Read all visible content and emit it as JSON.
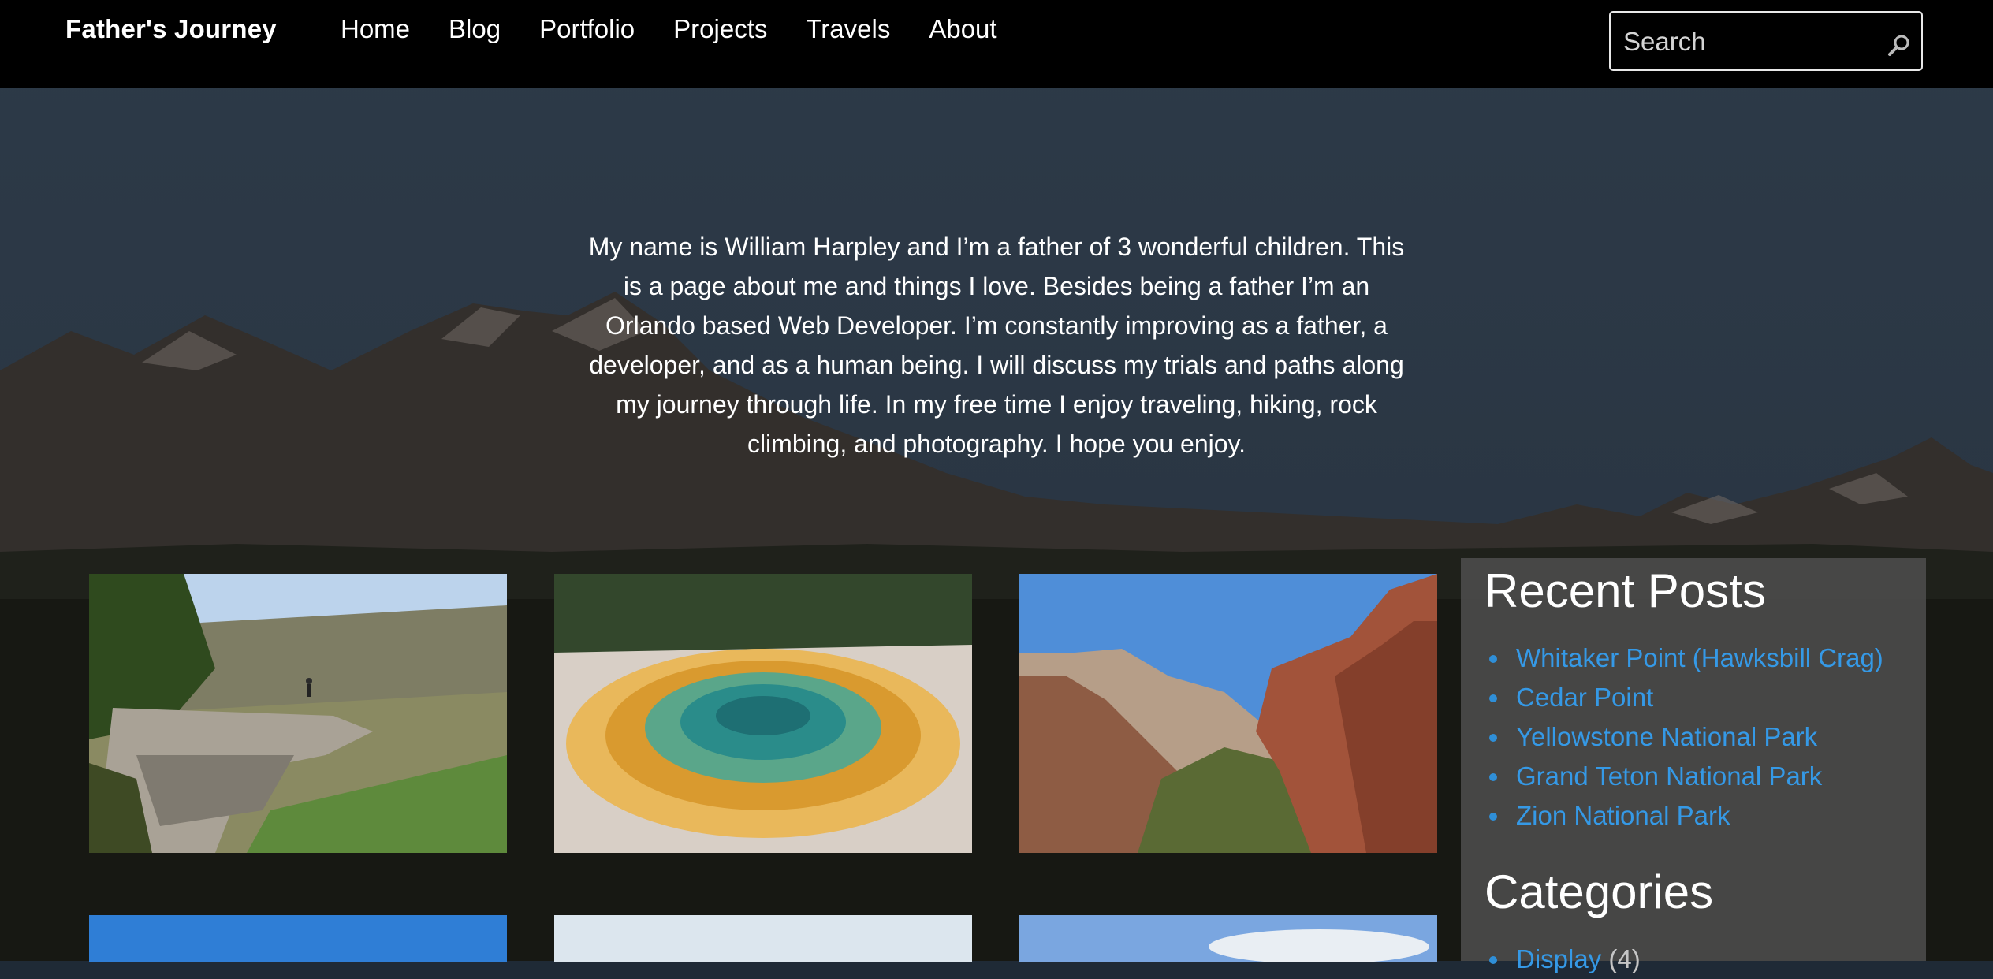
{
  "site": {
    "brand": "Father's Journey"
  },
  "nav": {
    "items": [
      "Home",
      "Blog",
      "Portfolio",
      "Projects",
      "Travels",
      "About"
    ]
  },
  "search": {
    "placeholder": "Search",
    "value": "",
    "icon": "search-icon"
  },
  "intro": {
    "text": "My name is William Harpley and I’m a father of 3 wonderful children. This is a page about me and things I love. Besides being a father I’m an Orlando based Web Developer. I’m constantly improving as a father, a developer, and as a human being. I will discuss my trials and paths along my journey through life. In my free time I enjoy traveling, hiking, rock climbing, and photography. I hope you enjoy."
  },
  "gallery": {
    "photos": [
      "cliff-overlook-photo",
      "hot-spring-photo",
      "canyon-photo",
      "blue-sky-photo",
      "hazy-sky-photo",
      "sky-clouds-photo"
    ]
  },
  "sidebar": {
    "recent_posts": {
      "title": "Recent Posts",
      "items": [
        "Whitaker Point (Hawksbill Crag)",
        "Cedar Point",
        "Yellowstone National Park",
        "Grand Teton National Park",
        "Zion National Park"
      ]
    },
    "categories": {
      "title": "Categories",
      "items": [
        {
          "label": "Display",
          "count": "(4)"
        }
      ]
    }
  },
  "colors": {
    "navbar": "#000000",
    "link": "#3599e6",
    "sidebar_bg": "#4e4e4e"
  }
}
